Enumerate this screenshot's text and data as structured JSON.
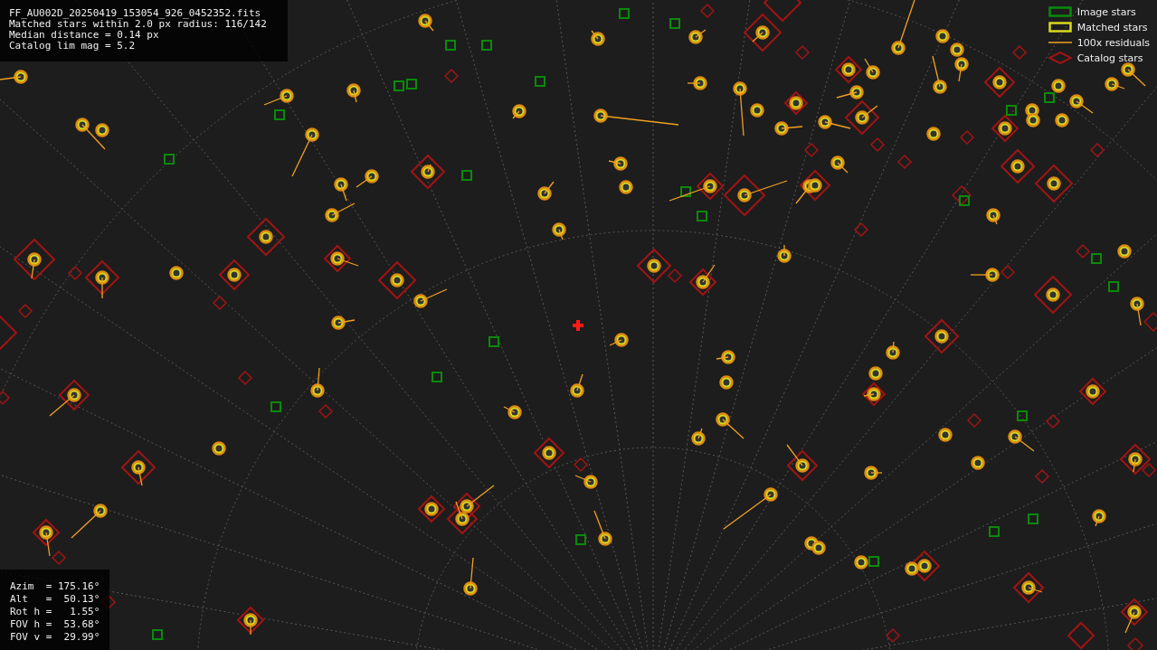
{
  "info": {
    "lines": [
      "FF_AU002D_20250419_153054_926_0452352.fits",
      "Matched stars within 2.0 px radius: 116/142",
      "Median distance = 0.14 px",
      "Catalog lim mag = 5.2"
    ]
  },
  "legend": [
    {
      "kind": "image",
      "label": "Image stars"
    },
    {
      "kind": "matched",
      "label": "Matched stars"
    },
    {
      "kind": "residual",
      "label": "100x residuals"
    },
    {
      "kind": "catalog",
      "label": "Catalog stars"
    }
  ],
  "pointing": {
    "lines": [
      "Azim  = 175.16°",
      "Alt   =  50.13°",
      "Rot h =   1.55°",
      "FOV h =  53.68°",
      "FOV v =  29.99°"
    ]
  }
}
